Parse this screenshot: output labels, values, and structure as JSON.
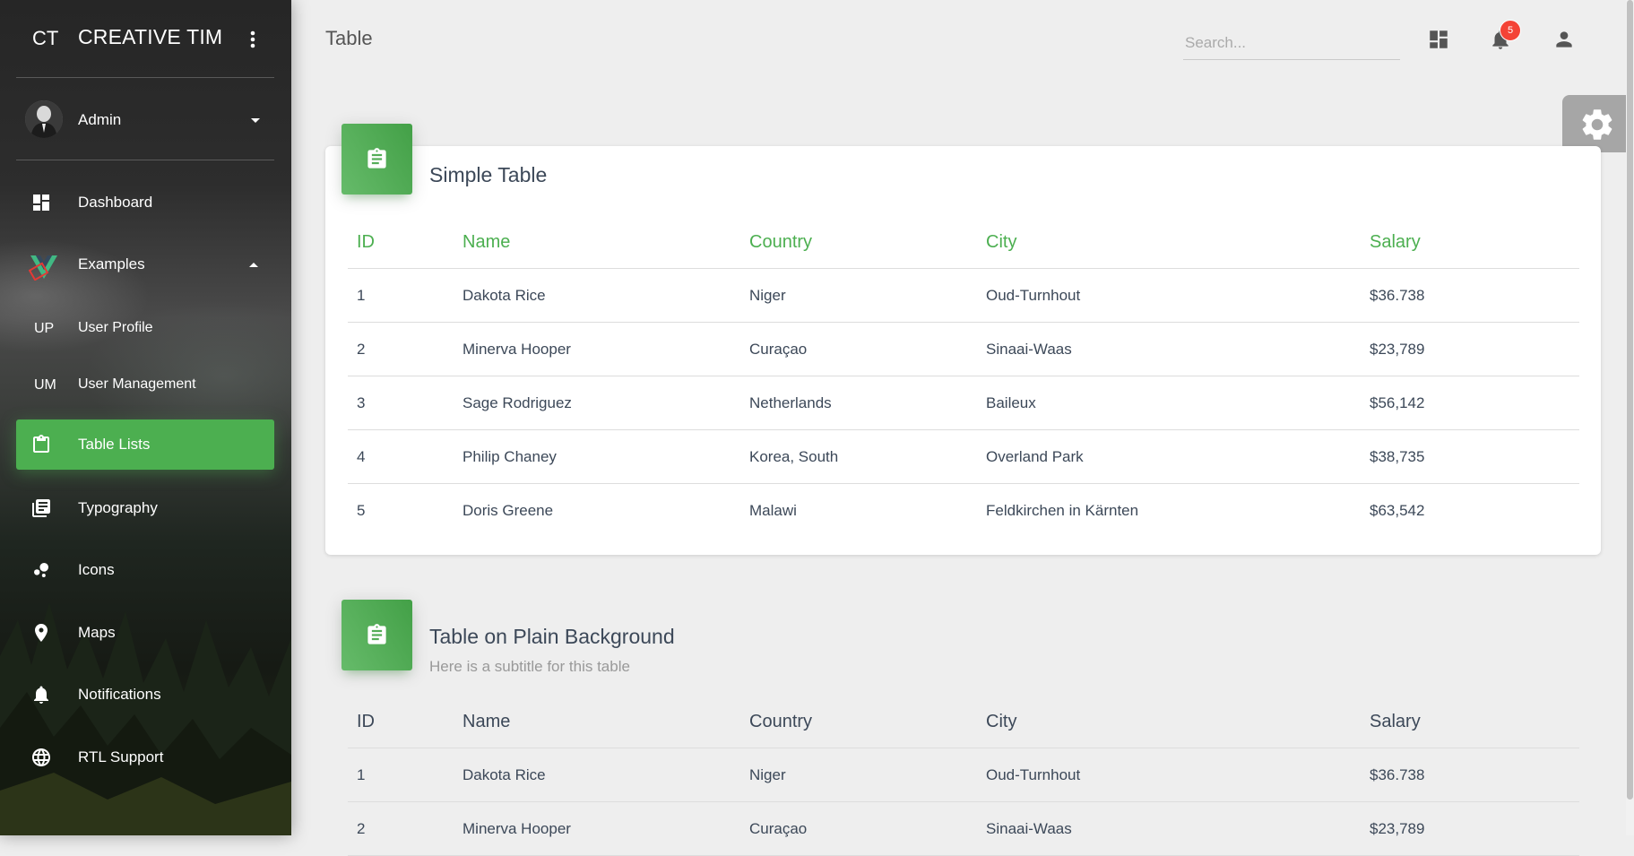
{
  "sidebar": {
    "logo_mini": "CT",
    "logo_text": "CREATIVE TIM",
    "user_name": "Admin",
    "items": [
      {
        "label": "Dashboard",
        "icon": "dashboard-icon"
      },
      {
        "label": "Examples",
        "icon": "vue-logo-icon"
      },
      {
        "mini": "UP",
        "label": "User Profile"
      },
      {
        "mini": "UM",
        "label": "User Management"
      },
      {
        "label": "Table Lists",
        "icon": "clipboard-icon",
        "active": true
      },
      {
        "label": "Typography",
        "icon": "library-books-icon"
      },
      {
        "label": "Icons",
        "icon": "bubble-chart-icon"
      },
      {
        "label": "Maps",
        "icon": "place-icon"
      },
      {
        "label": "Notifications",
        "icon": "bell-icon"
      },
      {
        "label": "RTL Support",
        "icon": "language-icon"
      }
    ]
  },
  "header": {
    "title": "Table",
    "search_placeholder": "Search...",
    "notification_count": "5"
  },
  "colors": {
    "accent": "#4caf50",
    "badge": "#f44336"
  },
  "simple_table": {
    "title": "Simple Table",
    "columns": [
      "ID",
      "Name",
      "Country",
      "City",
      "Salary"
    ],
    "rows": [
      [
        "1",
        "Dakota Rice",
        "Niger",
        "Oud-Turnhout",
        "$36.738"
      ],
      [
        "2",
        "Minerva Hooper",
        "Curaçao",
        "Sinaai-Waas",
        "$23,789"
      ],
      [
        "3",
        "Sage Rodriguez",
        "Netherlands",
        "Baileux",
        "$56,142"
      ],
      [
        "4",
        "Philip Chaney",
        "Korea, South",
        "Overland Park",
        "$38,735"
      ],
      [
        "5",
        "Doris Greene",
        "Malawi",
        "Feldkirchen in Kärnten",
        "$63,542"
      ]
    ]
  },
  "plain_table": {
    "title": "Table on Plain Background",
    "subtitle": "Here is a subtitle for this table",
    "columns": [
      "ID",
      "Name",
      "Country",
      "City",
      "Salary"
    ],
    "rows": [
      [
        "1",
        "Dakota Rice",
        "Niger",
        "Oud-Turnhout",
        "$36.738"
      ],
      [
        "2",
        "Minerva Hooper",
        "Curaçao",
        "Sinaai-Waas",
        "$23,789"
      ]
    ]
  }
}
